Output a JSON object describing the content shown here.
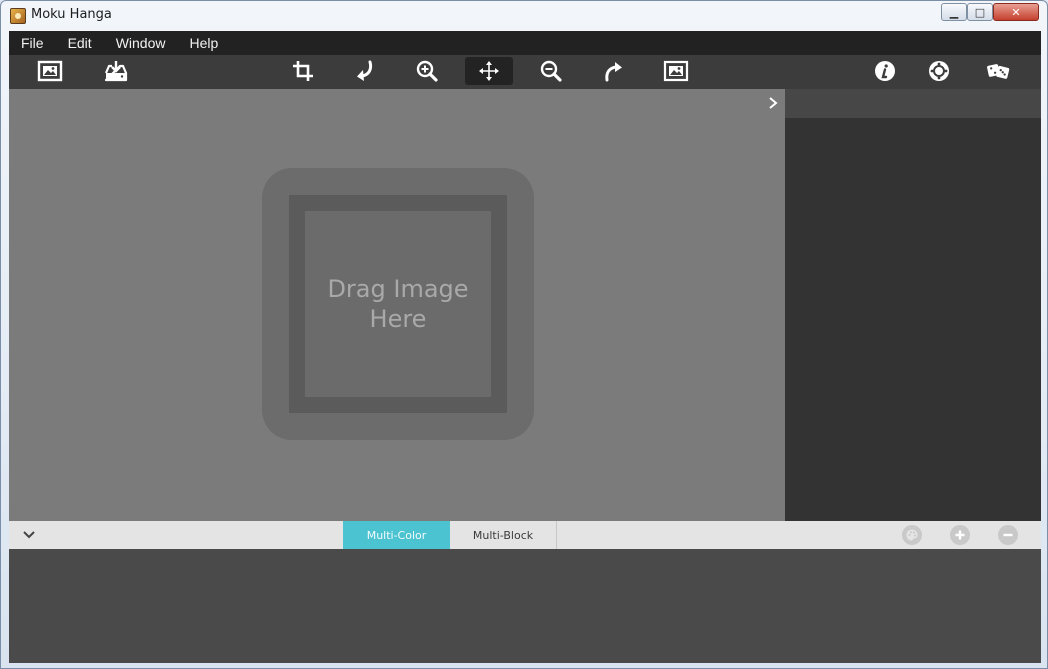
{
  "window": {
    "title": "Moku Hanga",
    "controls": {
      "minimize": "▁",
      "maximize": "□",
      "close": "✕"
    }
  },
  "menu": [
    "File",
    "Edit",
    "Window",
    "Help"
  ],
  "toolbar": {
    "left": [
      "open-image-icon",
      "save-download-icon"
    ],
    "center": [
      "crop-icon",
      "rotate-left-icon",
      "zoom-in-icon",
      "move-icon",
      "zoom-out-icon",
      "rotate-right-icon",
      "fit-image-icon"
    ],
    "right": [
      "info-icon",
      "settings-icon",
      "dice-icon"
    ],
    "active": "move-icon"
  },
  "canvas": {
    "drop_text_line1": "Drag Image",
    "drop_text_line2": "Here"
  },
  "bottom": {
    "tabs": [
      "Multi-Color",
      "Multi-Block"
    ],
    "active_tab": "Multi-Color",
    "actions": [
      "palette-icon",
      "add-icon",
      "remove-icon"
    ]
  },
  "colors": {
    "menubar": "#222222",
    "toolbar": "#3c3c3c",
    "canvas": "#7b7b7b",
    "side_panel": "#333333",
    "active_tab": "#4cc3d1",
    "bottom_panel": "#4a4a4a"
  }
}
